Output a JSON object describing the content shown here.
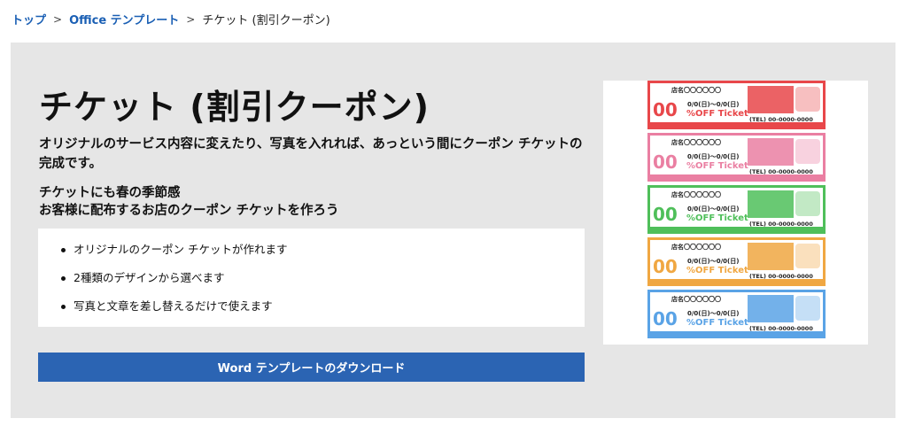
{
  "breadcrumb": {
    "home": "トップ",
    "office": "Office テンプレート",
    "current": "チケット (割引クーポン)",
    "separator": ">"
  },
  "hero": {
    "title": "チケット (割引クーポン)",
    "lead": "オリジナルのサービス内容に変えたり、写真を入れれば、あっという間にクーポン チケットの完成です。",
    "sub_line1": "チケットにも春の季節感",
    "sub_line2": "お客様に配布するお店のクーポン チケットを作ろう"
  },
  "features": [
    "オリジナルのクーポン チケットが作れます",
    "2種類のデザインから選べます",
    "写真と文章を差し替えるだけで使えます"
  ],
  "download_label": "Word テンプレートのダウンロード",
  "preview": {
    "shop": "店名〇〇〇〇〇〇",
    "date": "0/0(日)〜0/0(日)",
    "number": "00",
    "off": "%OFF Ticket",
    "tel": "(TEL) 00-0000-0000",
    "colors": [
      "#e8474a",
      "#ea7fa2",
      "#4fbf5a",
      "#f0a742",
      "#5aa3e6"
    ]
  }
}
